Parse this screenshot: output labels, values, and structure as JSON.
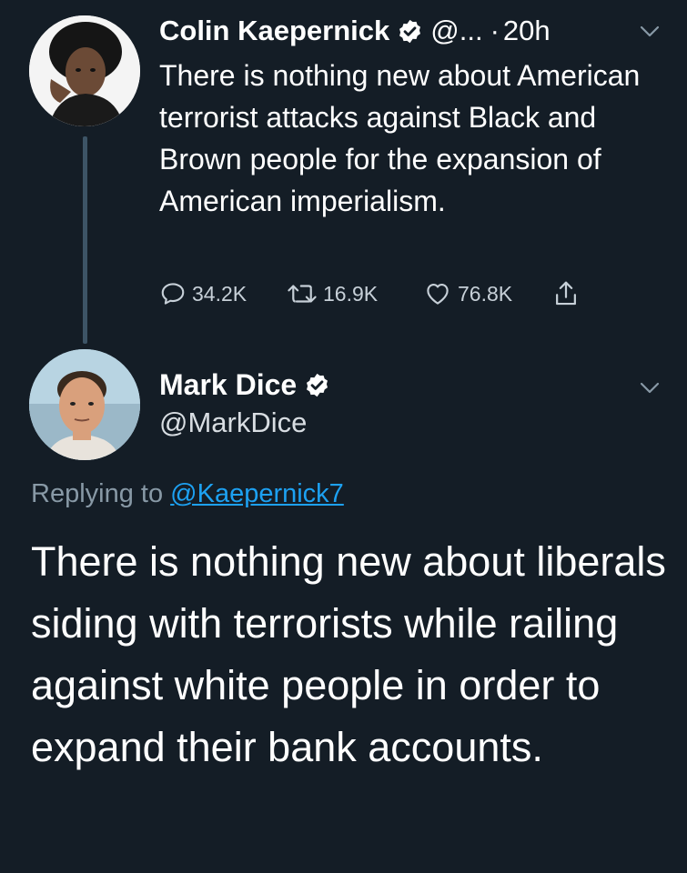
{
  "tweet1": {
    "author_name": "Colin Kaepernick",
    "handle": "@...",
    "separator": "·",
    "time": "20h",
    "text": "There is nothing new about American terrorist attacks against Black and Brown people for the expansion of American imperialism.",
    "replies": "34.2K",
    "retweets": "16.9K",
    "likes": "76.8K"
  },
  "tweet2": {
    "author_name": "Mark Dice",
    "handle": "@MarkDice",
    "replying_label": "Replying to",
    "replying_mention": "@Kaepernick7",
    "text": "There is nothing new about liberals siding with terrorists while railing against white people in order to expand their bank accounts."
  },
  "colors": {
    "background": "#141d26",
    "link": "#1da1f2",
    "verified": "#ffffff",
    "muted": "#8899a6"
  },
  "icons": {
    "verified": "verified-badge-icon",
    "chevron": "chevron-down-icon",
    "reply": "reply-icon",
    "retweet": "retweet-icon",
    "like": "heart-icon",
    "share": "share-icon"
  }
}
